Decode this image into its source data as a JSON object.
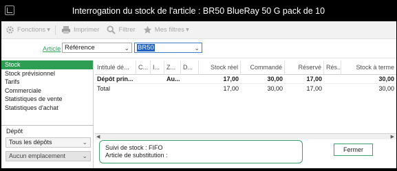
{
  "window": {
    "title": "Interrogation du stock de l'article : BR50 BlueRay 50 G pack de 10"
  },
  "toolbar": {
    "items": [
      {
        "label": "Fonctions",
        "icon": "gear-icon",
        "arrow": "▾"
      },
      {
        "label": "Imprimer",
        "icon": "printer-icon"
      },
      {
        "label": "Filtrer",
        "icon": "search-icon"
      },
      {
        "label": "Mes filtres",
        "icon": "star-icon",
        "arrow": "▾"
      }
    ]
  },
  "article": {
    "link_label": "Article",
    "field_type": "Référence",
    "field_value": "BR50"
  },
  "nav": {
    "items": [
      "Stock",
      "Stock prévisionnel",
      "Tarifs",
      "Commerciale",
      "Statistiques de vente",
      "Statistiques d'achat"
    ],
    "active_index": 0,
    "depot_label": "Dépôt",
    "depot_value": "Tous les dépôts",
    "emplacement_value": "Aucun emplacement"
  },
  "grid": {
    "columns": [
      "Intitulé dé...",
      "C...",
      "I...",
      "Z...",
      "D...",
      "Stock réel",
      "Commandé",
      "Réservé",
      "Rés...",
      "Stock à terme"
    ],
    "rows": [
      {
        "cells": [
          "Dépôt prin...",
          "",
          "",
          "Au...",
          "",
          "17,00",
          "30,00",
          "17,00",
          "",
          "30,00"
        ],
        "bold": true
      },
      {
        "cells": [
          "Total",
          "",
          "",
          "",
          "",
          "17,00",
          "30,00",
          "17,00",
          "",
          "30,00"
        ],
        "bold": false
      }
    ]
  },
  "info": {
    "suivi": "Suivi de stock : FIFO",
    "substitution": "Article de substitution :"
  },
  "buttons": {
    "close": "Fermer"
  },
  "colors": {
    "accent": "#2e9e55",
    "selection": "#2060c0",
    "titlebar": "#000000"
  }
}
